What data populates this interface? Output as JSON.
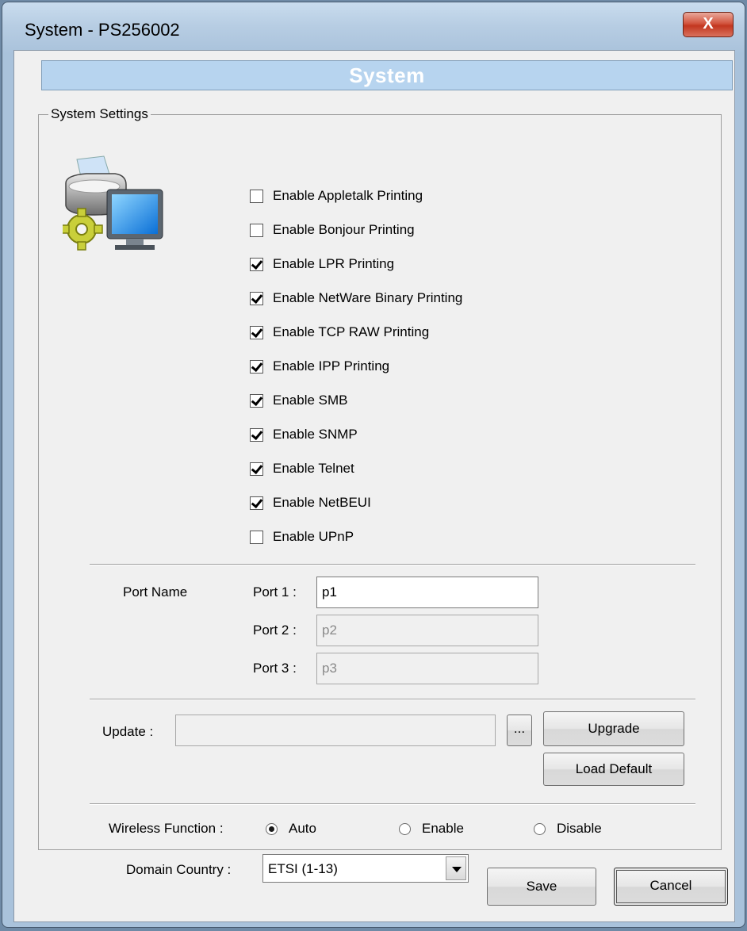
{
  "window": {
    "title": "System - PS256002",
    "close_glyph": "X"
  },
  "banner": {
    "title": "System"
  },
  "settings": {
    "group_title": "System Settings",
    "icon": "printer-monitor-gear-icon",
    "options": [
      {
        "label": "Enable Appletalk Printing",
        "checked": false
      },
      {
        "label": "Enable Bonjour Printing",
        "checked": false
      },
      {
        "label": "Enable LPR Printing",
        "checked": true
      },
      {
        "label": "Enable NetWare Binary Printing",
        "checked": true
      },
      {
        "label": "Enable TCP RAW Printing",
        "checked": true
      },
      {
        "label": "Enable IPP Printing",
        "checked": true
      },
      {
        "label": "Enable SMB",
        "checked": true
      },
      {
        "label": "Enable SNMP",
        "checked": true
      },
      {
        "label": "Enable Telnet",
        "checked": true
      },
      {
        "label": "Enable NetBEUI",
        "checked": true
      },
      {
        "label": "Enable UPnP",
        "checked": false
      }
    ]
  },
  "ports": {
    "section_label": "Port Name",
    "items": [
      {
        "label": "Port 1 :",
        "value": "p1",
        "enabled": true
      },
      {
        "label": "Port 2 :",
        "value": "p2",
        "enabled": false
      },
      {
        "label": "Port 3 :",
        "value": "p3",
        "enabled": false
      }
    ]
  },
  "update": {
    "label": "Update :",
    "value": "",
    "browse_label": "...",
    "upgrade_label": "Upgrade",
    "load_default_label": "Load Default"
  },
  "wireless": {
    "label": "Wireless Function :",
    "options": [
      "Auto",
      "Enable",
      "Disable"
    ],
    "selected": "Auto"
  },
  "domain": {
    "label": "Domain Country :",
    "selected": "ETSI (1-13)"
  },
  "footer": {
    "save_label": "Save",
    "cancel_label": "Cancel"
  },
  "colors": {
    "banner_bg": "#b7d4ef",
    "dialog_bg": "#f0f0f0",
    "close_red": "#c2361f"
  }
}
